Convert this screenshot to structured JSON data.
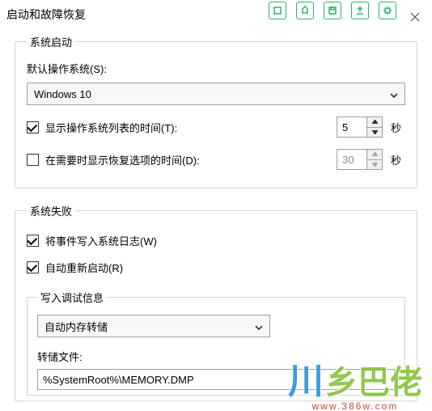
{
  "window": {
    "title": "启动和故障恢复"
  },
  "startup": {
    "group_title": "系统启动",
    "default_os_label": "默认操作系统(S):",
    "default_os_value": "Windows 10",
    "show_list": {
      "checked": true,
      "label": "显示操作系统列表的时间(T):",
      "value": "5",
      "unit": "秒"
    },
    "show_recovery": {
      "checked": false,
      "label": "在需要时显示恢复选项的时间(D):",
      "value": "30",
      "unit": "秒"
    }
  },
  "failure": {
    "group_title": "系统失败",
    "write_event": {
      "checked": true,
      "label": "将事件写入系统日志(W)"
    },
    "auto_restart": {
      "checked": true,
      "label": "自动重新启动(R)"
    },
    "debug": {
      "group_title": "写入调试信息",
      "mode_value": "自动内存转储",
      "dump_label": "转储文件:",
      "dump_path": "%SystemRoot%\\MEMORY.DMP"
    }
  },
  "watermark": {
    "brand_a": "川",
    "brand_b": "乡巴佬",
    "url": "www.386w.com"
  }
}
